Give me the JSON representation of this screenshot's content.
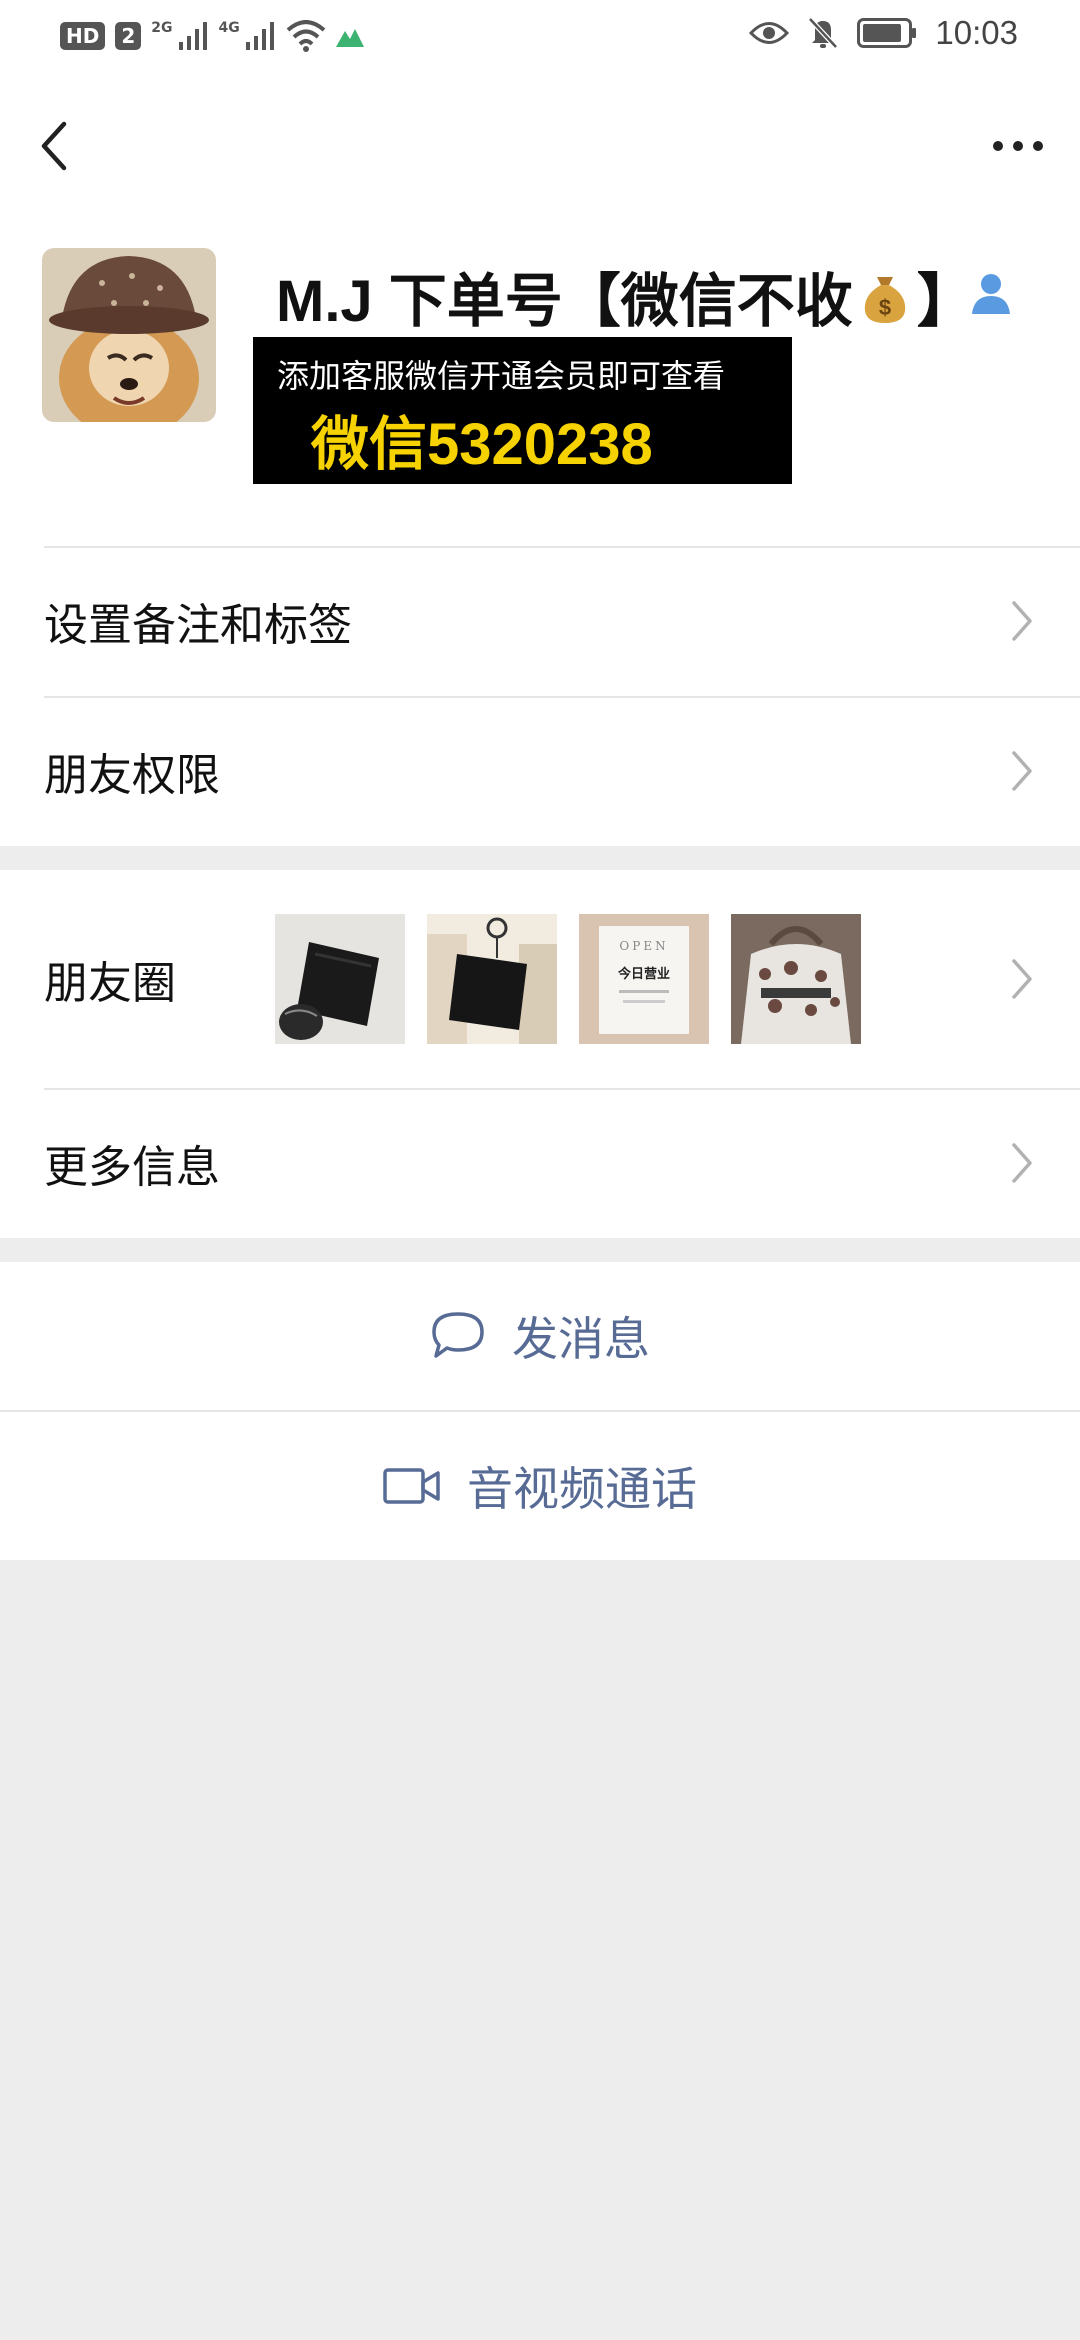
{
  "status_bar": {
    "hd_badge": "HD",
    "sim_badge": "2",
    "net1": "2G",
    "net2": "4G",
    "time": "10:03"
  },
  "profile": {
    "name": "M.J 下单号【微信不收",
    "name_end": "】",
    "promo_line1": "添加客服微信开通会员即可查看",
    "promo_line2": "微信5320238"
  },
  "rows": {
    "remark": "设置备注和标签",
    "permission": "朋友权限",
    "moments": "朋友圈",
    "more_info": "更多信息"
  },
  "actions": {
    "message": "发消息",
    "call": "音视频通话"
  },
  "moment_thumbs": [
    {
      "open_top": "",
      "open_mid": ""
    },
    {
      "open_top": "",
      "open_mid": ""
    },
    {
      "open_top": "OPEN",
      "open_mid": "今日营业"
    },
    {
      "open_top": "",
      "open_mid": ""
    }
  ],
  "colors": {
    "link": "#576b95",
    "banner_bg": "#000000",
    "banner_accent": "#f5d200",
    "page_bg": "#ededed"
  }
}
